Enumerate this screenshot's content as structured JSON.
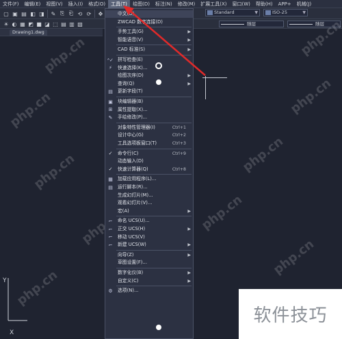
{
  "menubar": {
    "items": [
      "文件(F)",
      "编辑(E)",
      "视图(V)",
      "插入(I)",
      "格式(O)",
      "工具(T)",
      "绘图(D)",
      "标注(N)",
      "修改(M)",
      "扩展工具(X)",
      "窗口(W)",
      "帮助(H)",
      "APP+",
      "机械(J)"
    ]
  },
  "toolbar": {
    "textstyle_value": "Standard",
    "dimstyle_value": "ISO-25",
    "linetype1": "随层",
    "linetype2": "随层"
  },
  "file_tab": {
    "name": "Drawing1.dwg"
  },
  "tools_menu": {
    "items": [
      {
        "label": "中文(O)",
        "shortcut": "",
        "submenu": false,
        "icon": ""
      },
      {
        "label": "ZWCAD 数字连接(D)",
        "shortcut": "",
        "submenu": false,
        "icon": ""
      },
      {
        "label": "手势工具(G)",
        "shortcut": "",
        "submenu": true,
        "icon": ""
      },
      {
        "label": "智能语音(V)",
        "shortcut": "",
        "submenu": true,
        "icon": ""
      },
      {
        "label": "CAD 标准(S)",
        "shortcut": "",
        "submenu": true,
        "icon": ""
      },
      {
        "label": "拼写检查(E)",
        "shortcut": "",
        "submenu": false,
        "icon": "spellcheck-icon"
      },
      {
        "label": "快速选择(K)...",
        "shortcut": "",
        "submenu": false,
        "icon": "quick-select-icon"
      },
      {
        "label": "绘图次序(D)",
        "shortcut": "",
        "submenu": true,
        "icon": ""
      },
      {
        "label": "查询(Q)",
        "shortcut": "",
        "submenu": true,
        "icon": ""
      },
      {
        "label": "更新字段(T)",
        "shortcut": "",
        "submenu": false,
        "icon": "update-field-icon"
      },
      {
        "label": "块编辑器(B)",
        "shortcut": "",
        "submenu": false,
        "icon": "block-editor-icon"
      },
      {
        "label": "属性提取(X)...",
        "shortcut": "",
        "submenu": false,
        "icon": "attribute-extract-icon"
      },
      {
        "label": "手绘修改(P)...",
        "shortcut": "",
        "submenu": false,
        "icon": "sketch-icon"
      },
      {
        "label": "对象特性管理器(I)",
        "shortcut": "Ctrl+1",
        "submenu": false,
        "icon": ""
      },
      {
        "label": "设计中心(G)",
        "shortcut": "Ctrl+2",
        "submenu": false,
        "icon": ""
      },
      {
        "label": "工具选项板窗口(T)",
        "shortcut": "Ctrl+3",
        "submenu": false,
        "icon": ""
      },
      {
        "label": "命令行(C)",
        "shortcut": "Ctrl+9",
        "submenu": false,
        "icon": "check-icon"
      },
      {
        "label": "动态输入(D)",
        "shortcut": "",
        "submenu": false,
        "icon": ""
      },
      {
        "label": "快速计算器(Q)",
        "shortcut": "Ctrl+8",
        "submenu": false,
        "icon": "check-icon"
      },
      {
        "label": "加载应用程序(L)...",
        "shortcut": "",
        "submenu": false,
        "icon": "load-app-icon"
      },
      {
        "label": "运行脚本(R)...",
        "shortcut": "",
        "submenu": false,
        "icon": "script-icon"
      },
      {
        "label": "生成幻灯片(M)...",
        "shortcut": "",
        "submenu": false,
        "icon": ""
      },
      {
        "label": "观看幻灯片(V)...",
        "shortcut": "",
        "submenu": false,
        "icon": ""
      },
      {
        "label": "宏(A)",
        "shortcut": "",
        "submenu": true,
        "icon": ""
      },
      {
        "label": "命名 UCS(U)...",
        "shortcut": "",
        "submenu": false,
        "icon": "ucs-named-icon"
      },
      {
        "label": "正交 UCS(H)",
        "shortcut": "",
        "submenu": true,
        "icon": "ucs-ortho-icon"
      },
      {
        "label": "移动 UCS(V)",
        "shortcut": "",
        "submenu": false,
        "icon": "ucs-move-icon"
      },
      {
        "label": "新建 UCS(W)",
        "shortcut": "",
        "submenu": true,
        "icon": "ucs-new-icon"
      },
      {
        "label": "向导(Z)",
        "shortcut": "",
        "submenu": true,
        "icon": ""
      },
      {
        "label": "草图设置(F)...",
        "shortcut": "",
        "submenu": false,
        "icon": ""
      },
      {
        "label": "数字化仪(B)",
        "shortcut": "",
        "submenu": true,
        "icon": ""
      },
      {
        "label": "自定义(C)",
        "shortcut": "",
        "submenu": true,
        "icon": ""
      },
      {
        "label": "选项(N)...",
        "shortcut": "",
        "submenu": false,
        "icon": "options-icon"
      }
    ]
  },
  "watermark": {
    "site": "php.cn"
  },
  "brand": {
    "text": "软件技巧"
  },
  "colors": {
    "accent_red": "#e02a2a",
    "menu_bg": "#2c3142",
    "canvas_bg": "#1f2330"
  }
}
